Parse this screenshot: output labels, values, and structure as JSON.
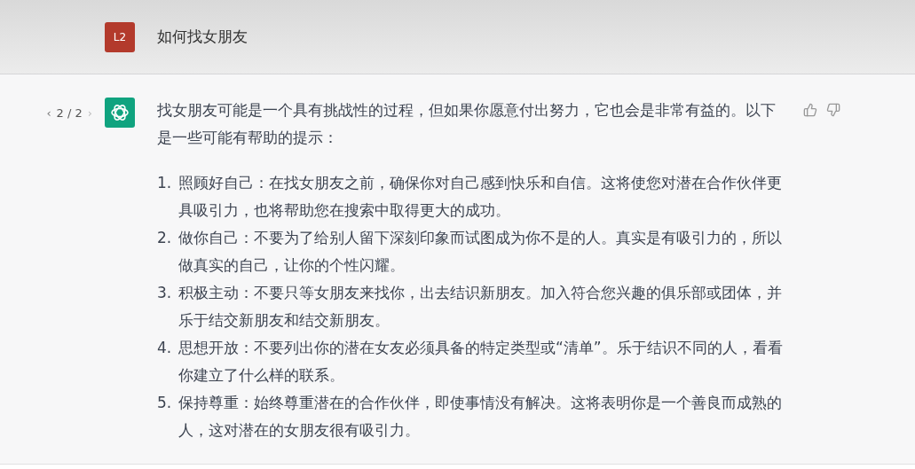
{
  "user_message": {
    "avatar": "L2",
    "text": "如何找女朋友"
  },
  "answer": {
    "pager": {
      "prev": "‹",
      "count": "2 / 2",
      "next": "›"
    },
    "intro": "找女朋友可能是一个具有挑战性的过程，但如果你愿意付出努力，它也会是非常有益的。以下是一些可能有帮助的提示：",
    "items": [
      {
        "number": "1.",
        "text": "照顾好自己：在找女朋友之前，确保你对自己感到快乐和自信。这将使您对潜在合作伙伴更具吸引力，也将帮助您在搜索中取得更大的成功。"
      },
      {
        "number": "2.",
        "text": "做你自己：不要为了给别人留下深刻印象而试图成为你不是的人。真实是有吸引力的，所以做真实的自己，让你的个性闪耀。"
      },
      {
        "number": "3.",
        "text": "积极主动：不要只等女朋友来找你，出去结识新朋友。加入符合您兴趣的俱乐部或团体，并乐于结交新朋友和结交新朋友。"
      },
      {
        "number": "4.",
        "text": "思想开放：不要列出你的潜在女友必须具备的特定类型或“清单”。乐于结识不同的人，看看你建立了什么样的联系。"
      },
      {
        "number": "5.",
        "text": "保持尊重：始终尊重潜在的合作伙伴，即使事情没有解决。这将表明你是一个善良而成熟的人，这对潜在的女朋友很有吸引力。"
      }
    ]
  }
}
